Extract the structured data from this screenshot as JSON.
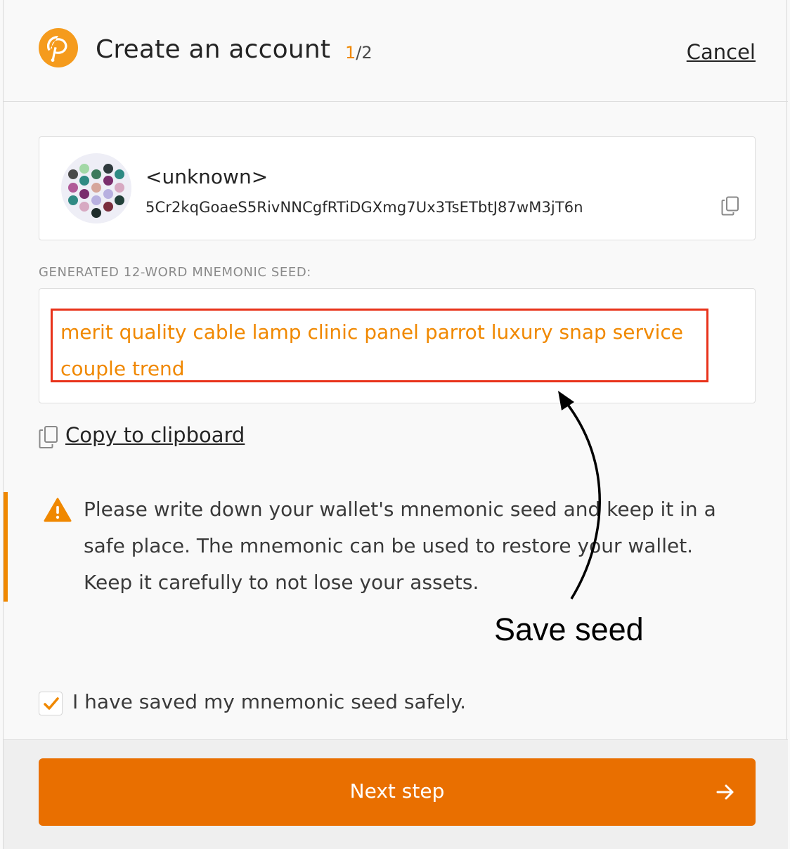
{
  "header": {
    "title": "Create an account",
    "step_current": "1",
    "step_total": "/2",
    "cancel_label": "Cancel"
  },
  "account": {
    "name": "<unknown>",
    "address": "5Cr2kqGoaeS5RivNNCgfRTiDGXmg7Ux3TsETbtJ87wM3jT6n"
  },
  "mnemonic": {
    "label": "GENERATED 12-WORD MNEMONIC SEED:",
    "seed": "merit quality cable lamp clinic panel parrot luxury snap service couple trend",
    "copy_label": "Copy to clipboard"
  },
  "warning": {
    "text": "Please write down your wallet's mnemonic seed and keep it in a safe place. The mnemonic can be used to restore your wallet. Keep it carefully to not lose your assets."
  },
  "annotation": {
    "label": "Save seed"
  },
  "confirm": {
    "label": "I have saved my mnemonic seed safely.",
    "checked": true
  },
  "footer": {
    "next_label": "Next step"
  },
  "colors": {
    "accent": "#f08800",
    "button": "#e96f00",
    "highlight_box": "#e8321a",
    "logo": "#f59b1d"
  },
  "icons": {
    "logo": "polkadot-logo-icon",
    "copy": "copy-icon",
    "warning": "warning-icon",
    "check": "checkmark-icon",
    "next": "arrow-right-icon"
  }
}
